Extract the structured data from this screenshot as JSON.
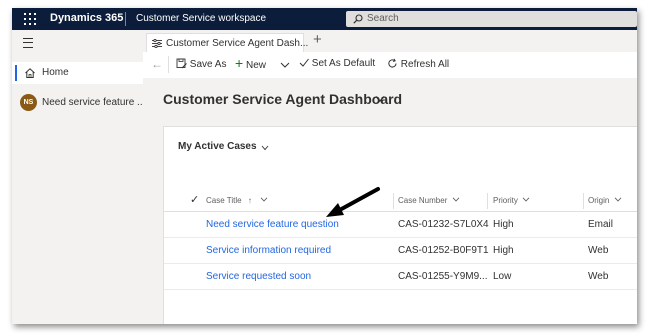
{
  "topbar": {
    "brand": "Dynamics 365",
    "app_title": "Customer Service workspace",
    "search_placeholder": "Search",
    "icons": [
      "waffle-icon",
      "search-icon"
    ],
    "colors": {
      "background": "#0b1d3a",
      "text": "#ffffff"
    }
  },
  "sidebar": {
    "items": [
      {
        "label": "Home",
        "icon": "home-icon",
        "selected": true
      },
      {
        "label": "Need service feature ...",
        "avatar": "NS",
        "avatar_color": "#8a5a15"
      }
    ]
  },
  "tabs": {
    "items": [
      {
        "label": "Customer Service Agent Dash..."
      }
    ],
    "new_tab_glyph": "+"
  },
  "commands": {
    "save_as": "Save As",
    "new": "New",
    "set_as_default": "Set As Default",
    "refresh_all": "Refresh All"
  },
  "dashboard": {
    "title": "Customer Service Agent Dashboard",
    "view_title": "My Active Cases",
    "columns": [
      "Case Title",
      "Case Number",
      "Priority",
      "Origin"
    ],
    "sort": {
      "column": "Case Title",
      "direction": "ascending",
      "arrow": "↑"
    },
    "rows": [
      {
        "title": "Need service feature question",
        "number": "CAS-01232-S7L0X4",
        "priority": "High",
        "origin": "Email"
      },
      {
        "title": "Service information required",
        "number": "CAS-01252-B0F9T1",
        "priority": "High",
        "origin": "Web"
      },
      {
        "title": "Service requested soon",
        "number": "CAS-01255-Y9M9...",
        "priority": "Low",
        "origin": "Web"
      }
    ],
    "colors": {
      "link": "#2266e3",
      "accent": "#2266e3"
    }
  }
}
